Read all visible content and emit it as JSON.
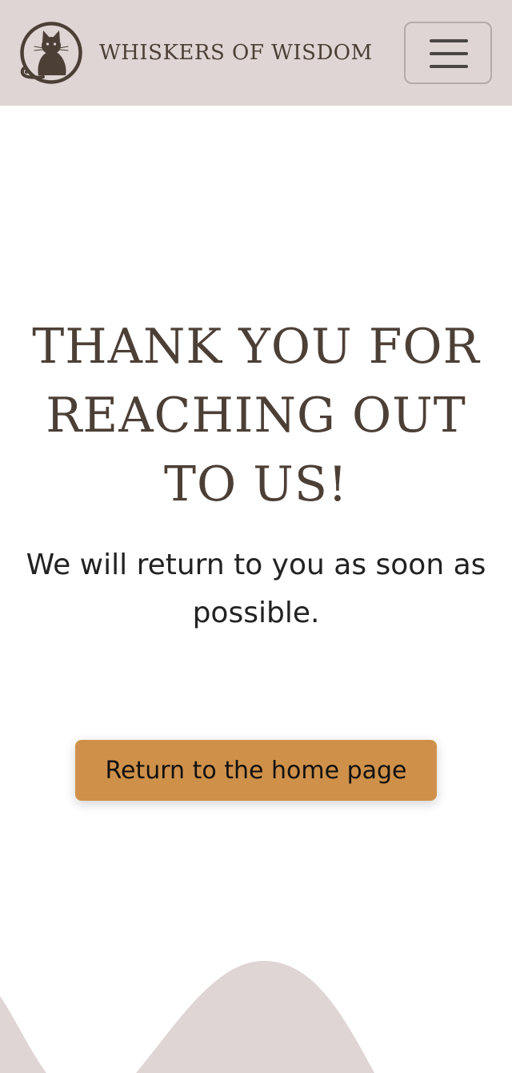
{
  "header": {
    "brand_name": "WHISKERS OF WISDOM",
    "logo_icon": "cat-logo-icon",
    "menu_icon": "hamburger-menu-icon"
  },
  "main": {
    "heading": "THANK YOU FOR REACHING OUT TO US!",
    "message": "We will return to you as soon as possible.",
    "home_button_label": "Return to the home page"
  },
  "colors": {
    "header_background": "#dfd5d4",
    "brand_text": "#4c3f36",
    "heading_text": "#4c3f36",
    "body_text": "#222222",
    "button_background": "#cf914a",
    "wave": "#dfd5d4",
    "page_background": "#ffffff"
  }
}
